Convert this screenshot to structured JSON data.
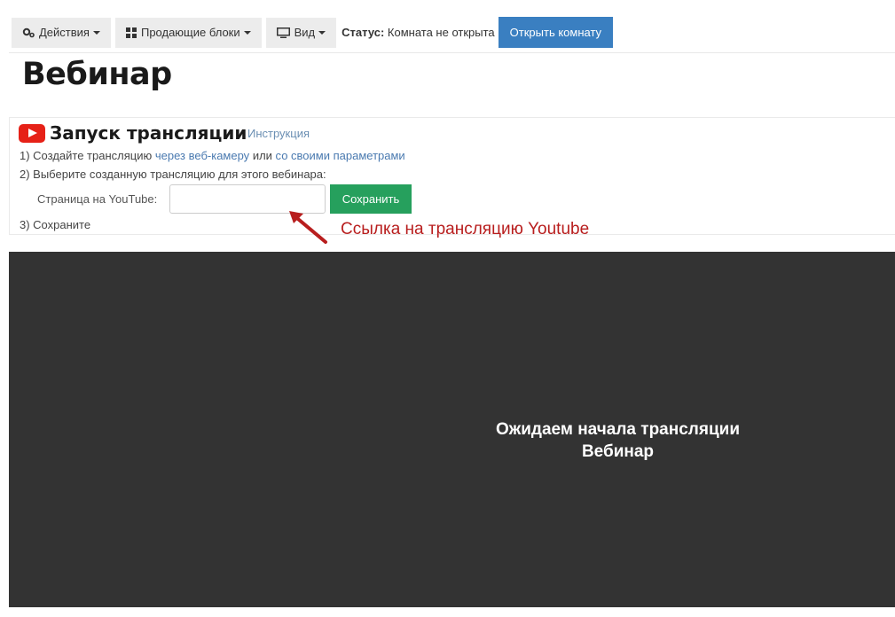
{
  "toolbar": {
    "actions_label": "Действия",
    "blocks_label": "Продающие блоки",
    "view_label": "Вид",
    "status_key": "Статус:",
    "status_value": "Комната не открыта",
    "open_room_label": "Открыть комнату"
  },
  "page": {
    "title": "Вебинар"
  },
  "broadcast": {
    "title": "Запуск трансляции",
    "instruction_link": "Инструкция",
    "step1_prefix": "1) Создайте трансляцию",
    "step1_link1": "через веб-камеру",
    "step1_mid": "или",
    "step1_link2": "со своими параметрами",
    "step2": "2) Выберите созданную трансляцию для этого вебинара:",
    "youtube_label": "Страница на YouTube:",
    "youtube_input_value": "",
    "save_label": "Сохранить",
    "step3": "3) Сохраните"
  },
  "annotation": {
    "text": "Ссылка на трансляцию Youtube",
    "color": "#b81e1e"
  },
  "video": {
    "line1": "Ожидаем начала трансляции",
    "line2": "Вебинар"
  },
  "colors": {
    "primary": "#3a7fc1",
    "success": "#26a05d",
    "youtube": "#e62117",
    "video_bg": "#333333"
  },
  "icons": [
    "gears-icon",
    "grid-icon",
    "monitor-icon",
    "youtube-icon",
    "arrow-icon"
  ]
}
